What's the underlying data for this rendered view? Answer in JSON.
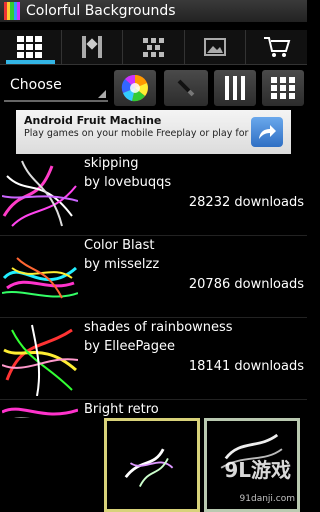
{
  "app": {
    "title": "Colorful Backgrounds"
  },
  "colors": {
    "accent": "#33b5e5",
    "ad_button": "#2f6fc4"
  },
  "tabs": [
    {
      "icon": "grid-icon",
      "active": true
    },
    {
      "icon": "single-wallpaper-icon",
      "active": false
    },
    {
      "icon": "pattern-icon",
      "active": false
    },
    {
      "icon": "picture-icon",
      "active": false
    },
    {
      "icon": "shopping-cart-icon",
      "active": false
    }
  ],
  "controls": {
    "choose_label": "Choose",
    "buttons": [
      "color-wheel-icon",
      "brush-icon",
      "columns-icon",
      "grid-icon"
    ]
  },
  "ad": {
    "title": "Android Fruit Machine",
    "subtitle": "Play games on your mobile Freeplay or play for real.",
    "button_icon": "share-arrow-icon"
  },
  "list": [
    {
      "title": "skipping",
      "author": "by lovebuqqs",
      "downloads": "28232 downloads"
    },
    {
      "title": "Color Blast",
      "author": "by misselzz",
      "downloads": "20786 downloads"
    },
    {
      "title": "shades of rainbowness",
      "author": "by ElleePagee",
      "downloads": "18141 downloads"
    },
    {
      "title": "Bright retro",
      "author": "",
      "downloads": ""
    }
  ],
  "watermark": {
    "logo": "9L游戏",
    "url": "91danji.com"
  }
}
